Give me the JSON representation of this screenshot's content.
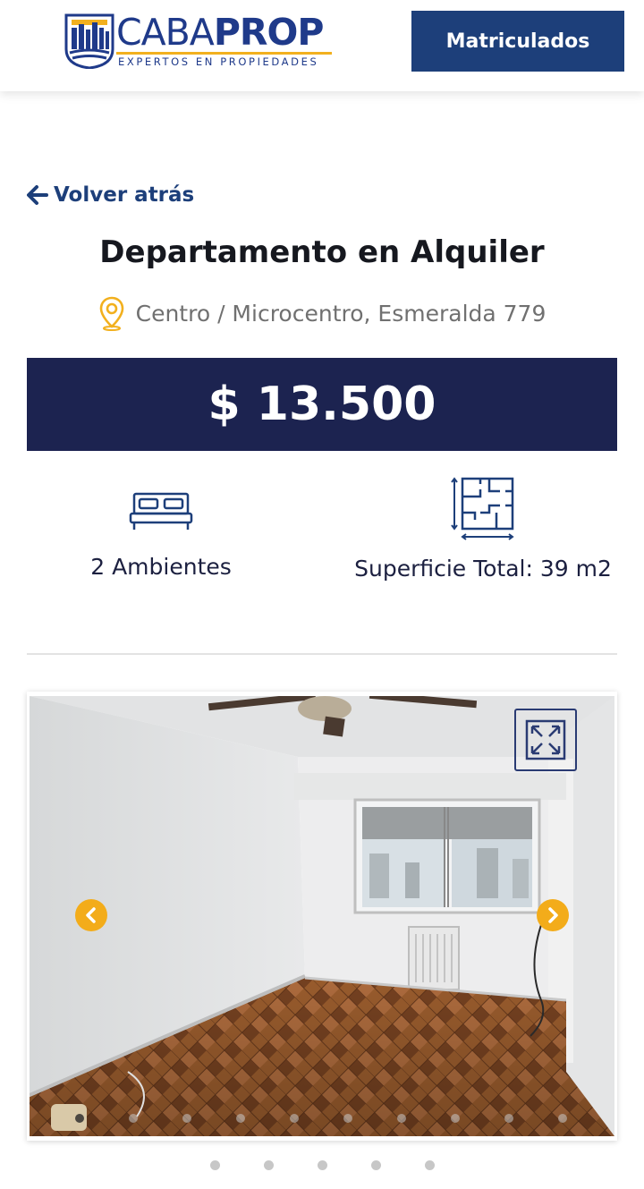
{
  "header": {
    "logo": {
      "word_light": "CABA",
      "word_bold": "PROP",
      "tagline": "EXPERTOS EN PROPIEDADES"
    },
    "matriculados_label": "Matriculados"
  },
  "nav": {
    "back_label": "Volver atrás",
    "back_icon": "arrow-left-icon"
  },
  "listing": {
    "title": "Departamento en Alquiler",
    "location_icon": "map-pin-icon",
    "location": "Centro / Microcentro, Esmeralda 779",
    "price": "$ 13.500",
    "features": [
      {
        "icon": "bed-icon",
        "label": "2 Ambientes"
      },
      {
        "icon": "floor-plan-icon",
        "label": "Superficie Total: 39 m2"
      }
    ]
  },
  "gallery": {
    "expand_icon": "expand-icon",
    "prev_icon": "chevron-left-icon",
    "next_icon": "chevron-right-icon",
    "inner_dot_count": 10,
    "inner_active_index": 0,
    "outer_dot_count": 5
  },
  "colors": {
    "navy": "#1c2350",
    "brand_blue": "#1d3f7a",
    "accent_yellow": "#f3ac1a"
  }
}
